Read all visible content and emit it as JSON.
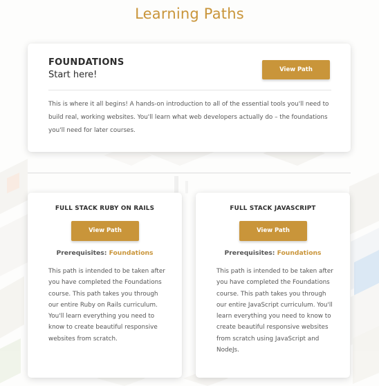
{
  "page": {
    "title": "Learning Paths"
  },
  "foundations": {
    "title": "FOUNDATIONS",
    "subtitle": "Start here!",
    "button_label": "View Path",
    "description": "This is where it all begins! A hands-on introduction to all of the essential tools you'll need to build real, working websites. You'll learn what web developers actually do – the foundations you'll need for later courses."
  },
  "paths": [
    {
      "title": "FULL STACK RUBY ON RAILS",
      "button_label": "View Path",
      "prereq_label": "Prerequisites:",
      "prereq_link": "Foundations",
      "description": "This path is intended to be taken after you have completed the Foundations course. This path takes you through our entire Ruby on Rails curriculum. You'll learn everything you need to know to create beautiful responsive websites from scratch."
    },
    {
      "title": "FULL STACK JAVASCRIPT",
      "button_label": "View Path",
      "prereq_label": "Prerequisites:",
      "prereq_link": "Foundations",
      "description": "This path is intended to be taken after you have completed the Foundations course. This path takes you through our entire JavaScript curriculum. You'll learn everything you need to know to create beautiful responsive websites from scratch using JavaScript and NodeJs."
    }
  ],
  "colors": {
    "accent": "#c9953a",
    "heading": "#2c2c2c",
    "body_text": "#555555",
    "card_bg": "#ffffff"
  }
}
